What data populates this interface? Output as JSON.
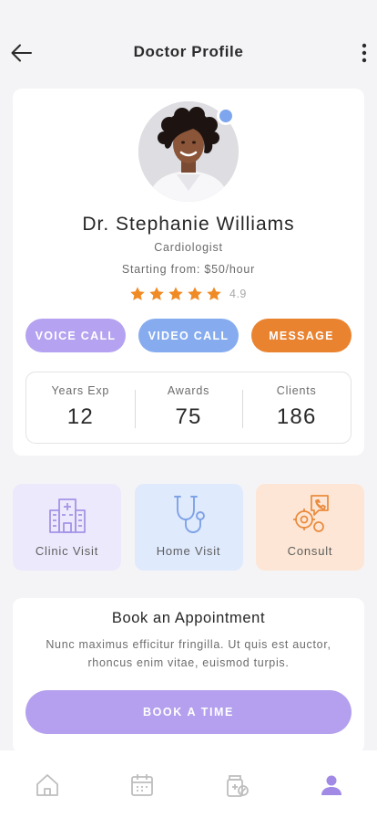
{
  "header": {
    "title": "Doctor Profile"
  },
  "profile": {
    "name": "Dr. Stephanie Williams",
    "specialty": "Cardiologist",
    "price": "Starting from: $50/hour",
    "rating": 4.9,
    "rating_text": "4.9",
    "stars_filled": 5,
    "stars_total": 5,
    "online": true
  },
  "actions": {
    "voice_call": "VOICE CALL",
    "video_call": "VIDEO CALL",
    "message": "MESSAGE"
  },
  "stats": [
    {
      "label": "Years Exp",
      "value": "12"
    },
    {
      "label": "Awards",
      "value": "75"
    },
    {
      "label": "Clients",
      "value": "186"
    }
  ],
  "services": [
    {
      "label": "Clinic Visit",
      "icon": "hospital-icon"
    },
    {
      "label": "Home Visit",
      "icon": "stethoscope-icon"
    },
    {
      "label": "Consult",
      "icon": "consult-icon"
    }
  ],
  "booking": {
    "title": "Book an Appointment",
    "description": "Nunc maximus efficitur fringilla. Ut quis est auctor, rhoncus enim vitae, euismod turpis.",
    "button": "BOOK A TIME"
  },
  "tabbar": {
    "items": [
      "home-icon",
      "calendar-icon",
      "medical-records-icon",
      "profile-icon"
    ],
    "active": "profile-icon"
  },
  "colors": {
    "accent_purple": "#b4a0ee",
    "accent_blue": "#86acef",
    "accent_orange": "#e98330",
    "star": "#f08a24",
    "online": "#7ea6ee"
  }
}
